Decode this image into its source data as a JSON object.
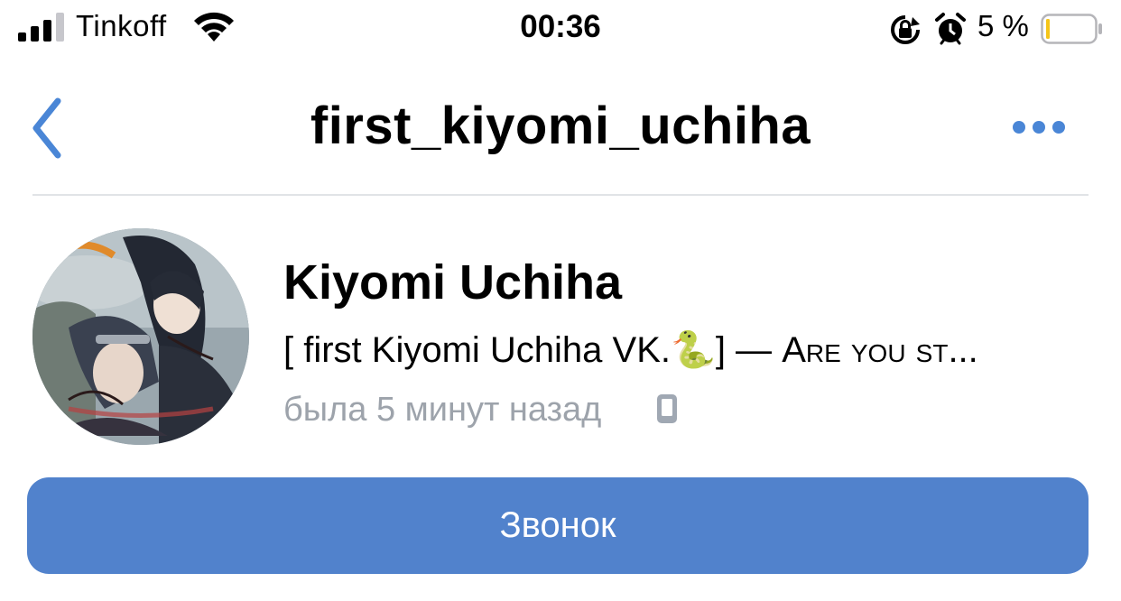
{
  "status_bar": {
    "carrier": "Tinkoff",
    "time": "00:36",
    "battery_percent": "5 %",
    "battery_level": 0.05,
    "icons": [
      "signal-icon",
      "wifi-icon",
      "rotation-lock-icon",
      "alarm-icon",
      "battery-icon"
    ]
  },
  "nav": {
    "title": "first_kiyomi_uchiha",
    "back_icon": "chevron-left-icon",
    "more_icon": "more-horizontal-icon",
    "accent_color": "#4a86d6"
  },
  "profile": {
    "name": "Kiyomi Uchiha",
    "status_prefix": "[ first Kiyomi Uchiha VK.",
    "status_emoji": "🐍",
    "status_suffix": "] —",
    "status_caps": "Are you st...",
    "last_seen": "была 5 минут назад",
    "device_icon": "mobile-phone-icon"
  },
  "actions": {
    "call_label": "Звонок",
    "call_color": "#5182cc"
  }
}
